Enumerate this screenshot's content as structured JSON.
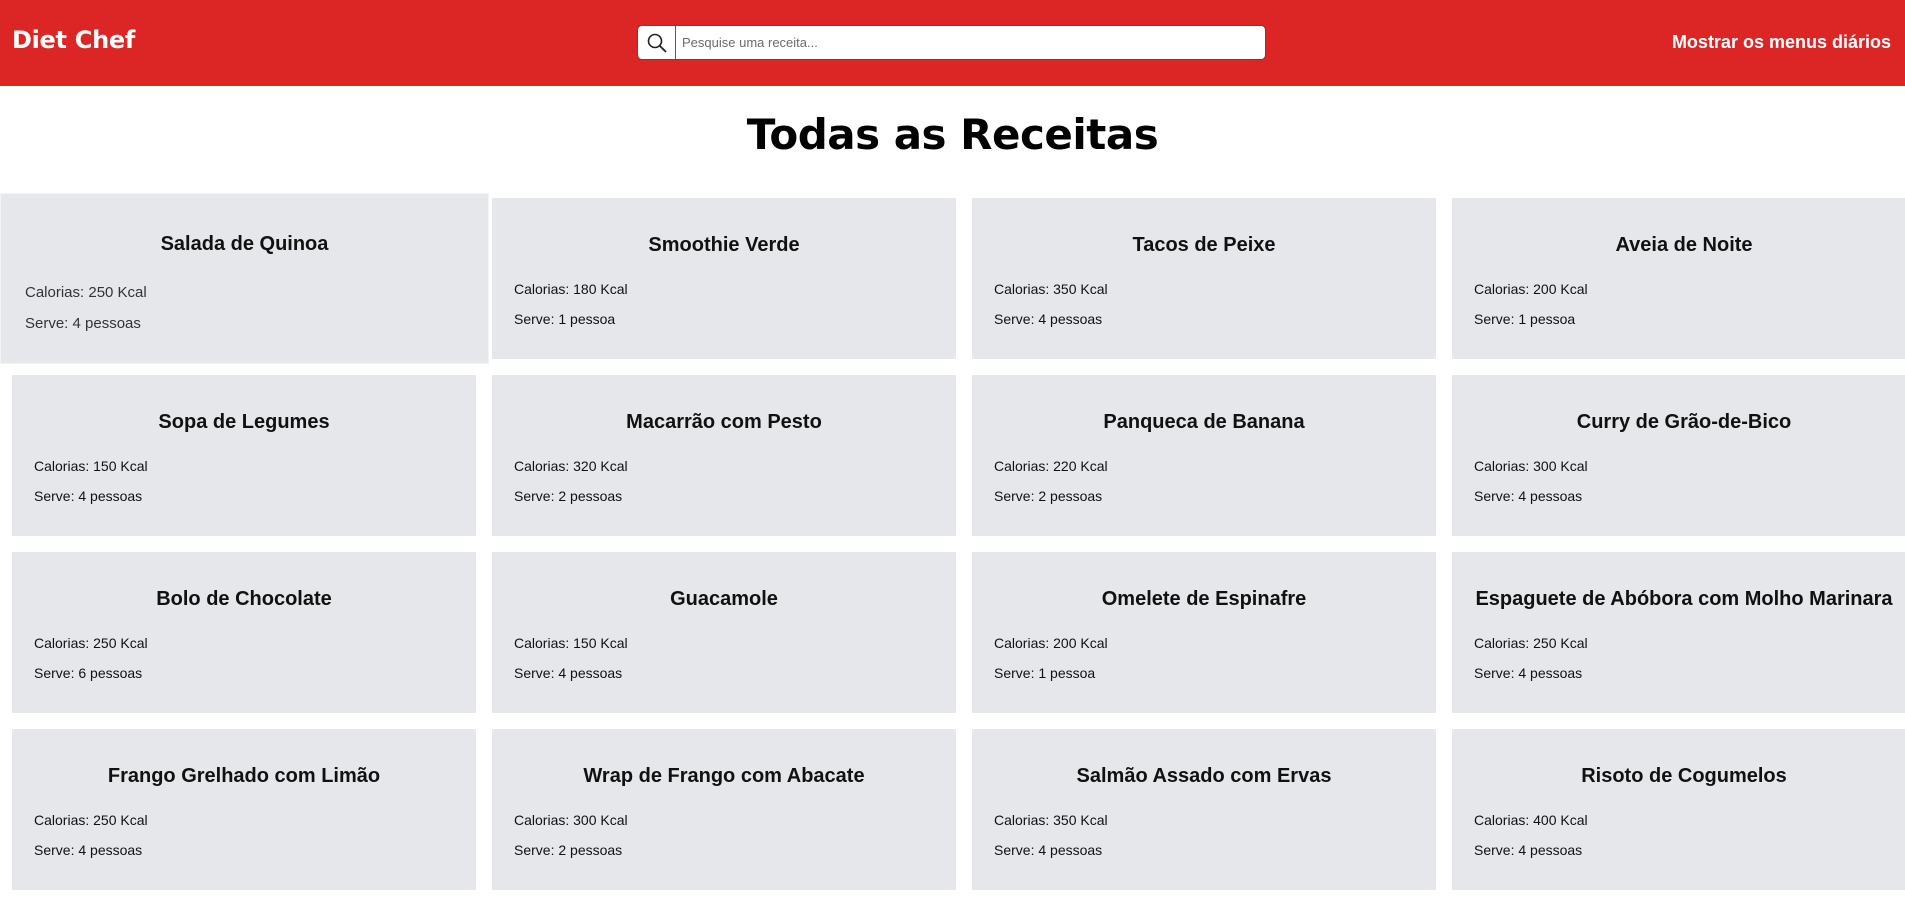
{
  "header": {
    "logo": "Diet Chef",
    "search_placeholder": "Pesquise uma receita...",
    "menus_link": "Mostrar os menus diários",
    "brand_color": "#dc2626"
  },
  "page_title": "Todas as Receitas",
  "card_background": "#e5e7eb",
  "recipes": [
    {
      "name": "Salada de Quinoa",
      "calories": "Calorias: 250 Kcal",
      "serves": "Serve: 4 pessoas"
    },
    {
      "name": "Smoothie Verde",
      "calories": "Calorias: 180 Kcal",
      "serves": "Serve: 1 pessoa"
    },
    {
      "name": "Tacos de Peixe",
      "calories": "Calorias: 350 Kcal",
      "serves": "Serve: 4 pessoas"
    },
    {
      "name": "Aveia de Noite",
      "calories": "Calorias: 200 Kcal",
      "serves": "Serve: 1 pessoa"
    },
    {
      "name": "Sopa de Legumes",
      "calories": "Calorias: 150 Kcal",
      "serves": "Serve: 4 pessoas"
    },
    {
      "name": "Macarrão com Pesto",
      "calories": "Calorias: 320 Kcal",
      "serves": "Serve: 2 pessoas"
    },
    {
      "name": "Panqueca de Banana",
      "calories": "Calorias: 220 Kcal",
      "serves": "Serve: 2 pessoas"
    },
    {
      "name": "Curry de Grão-de-Bico",
      "calories": "Calorias: 300 Kcal",
      "serves": "Serve: 4 pessoas"
    },
    {
      "name": "Bolo de Chocolate",
      "calories": "Calorias: 250 Kcal",
      "serves": "Serve: 6 pessoas"
    },
    {
      "name": "Guacamole",
      "calories": "Calorias: 150 Kcal",
      "serves": "Serve: 4 pessoas"
    },
    {
      "name": "Omelete de Espinafre",
      "calories": "Calorias: 200 Kcal",
      "serves": "Serve: 1 pessoa"
    },
    {
      "name": "Espaguete de Abóbora com Molho Marinara",
      "calories": "Calorias: 250 Kcal",
      "serves": "Serve: 4 pessoas"
    },
    {
      "name": "Frango Grelhado com Limão",
      "calories": "Calorias: 250 Kcal",
      "serves": "Serve: 4 pessoas"
    },
    {
      "name": "Wrap de Frango com Abacate",
      "calories": "Calorias: 300 Kcal",
      "serves": "Serve: 2 pessoas"
    },
    {
      "name": "Salmão Assado com Ervas",
      "calories": "Calorias: 350 Kcal",
      "serves": "Serve: 4 pessoas"
    },
    {
      "name": "Risoto de Cogumelos",
      "calories": "Calorias: 400 Kcal",
      "serves": "Serve: 4 pessoas"
    }
  ]
}
